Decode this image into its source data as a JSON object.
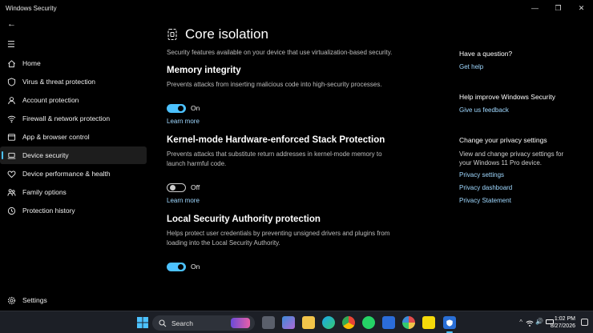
{
  "window": {
    "title": "Windows Security",
    "minimize": "—",
    "maximize": "❐",
    "close": "✕"
  },
  "sidebar": {
    "back_glyph": "←",
    "menu_glyph": "☰",
    "items": [
      {
        "label": "Home",
        "icon": "home-icon"
      },
      {
        "label": "Virus & threat protection",
        "icon": "shield-icon"
      },
      {
        "label": "Account protection",
        "icon": "person-icon"
      },
      {
        "label": "Firewall & network protection",
        "icon": "wifi-icon"
      },
      {
        "label": "App & browser control",
        "icon": "app-window-icon"
      },
      {
        "label": "Device security",
        "icon": "laptop-icon"
      },
      {
        "label": "Device performance & health",
        "icon": "heart-icon"
      },
      {
        "label": "Family options",
        "icon": "family-icon"
      },
      {
        "label": "Protection history",
        "icon": "history-icon"
      }
    ],
    "settings_label": "Settings"
  },
  "main": {
    "title": "Core isolation",
    "description": "Security features available on your device that use virtualization-based security.",
    "sections": [
      {
        "title": "Memory integrity",
        "description": "Prevents attacks from inserting malicious code into high-security processes.",
        "toggle_state": "On",
        "learn_more": "Learn more"
      },
      {
        "title": "Kernel-mode Hardware-enforced Stack Protection",
        "description": "Prevents attacks that substitute return addresses in kernel-mode memory to launch harmful code.",
        "toggle_state": "Off",
        "learn_more": "Learn more"
      },
      {
        "title": "Local Security Authority protection",
        "description": "Helps protect user credentials by preventing unsigned drivers and plugins from loading into the Local Security Authority.",
        "toggle_state": "On"
      }
    ]
  },
  "right": {
    "question_heading": "Have a question?",
    "get_help": "Get help",
    "improve_heading": "Help improve Windows Security",
    "feedback": "Give us feedback",
    "privacy_heading": "Change your privacy settings",
    "privacy_text": "View and change privacy settings for your Windows 11 Pro device.",
    "privacy_settings": "Privacy settings",
    "privacy_dashboard": "Privacy dashboard",
    "privacy_statement": "Privacy Statement"
  },
  "taskbar": {
    "search_placeholder": "Search",
    "time": "1:02 PM",
    "date": "8/27/2026"
  },
  "colors": {
    "accent": "#4cc2ff",
    "link": "#9fd8ff",
    "background": "#000000",
    "taskbar": "#1c1f26"
  }
}
